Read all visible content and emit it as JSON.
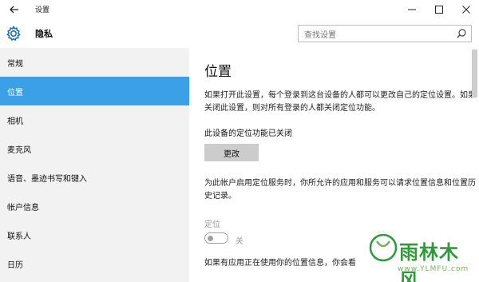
{
  "window": {
    "title": "设置"
  },
  "header": {
    "title": "隐私",
    "search_placeholder": "查找设置"
  },
  "sidebar": {
    "items": [
      {
        "label": "常规",
        "active": false
      },
      {
        "label": "位置",
        "active": true
      },
      {
        "label": "相机",
        "active": false
      },
      {
        "label": "麦克风",
        "active": false
      },
      {
        "label": "语音、墨迹书写和键入",
        "active": false
      },
      {
        "label": "帐户信息",
        "active": false
      },
      {
        "label": "联系人",
        "active": false
      },
      {
        "label": "日历",
        "active": false
      }
    ]
  },
  "main": {
    "title": "位置",
    "description": "如果打开此设置，每个登录到这台设备的人都可以更改自己的定位设置。如果关闭此设置，则对所有登录的人都关闭定位功能。",
    "device_status": "此设备的定位功能已关闭",
    "change_button": "更改",
    "account_description": "为此帐户启用定位服务时，你所允许的应用和服务可以请求位置信息和位置历史记录。",
    "toggle_label": "定位",
    "toggle_state": "关",
    "toggle_on": false,
    "bottom_text": "如果有应用正在使用你的位置信息，你会看"
  },
  "watermark": {
    "title": "雨林木风",
    "url": "www.YLMFU.com"
  },
  "colors": {
    "accent": "#3ba0e6",
    "sidebar_bg": "#f2f2f2",
    "button_bg": "#cccccc",
    "disabled_text": "#9a9a9a"
  }
}
